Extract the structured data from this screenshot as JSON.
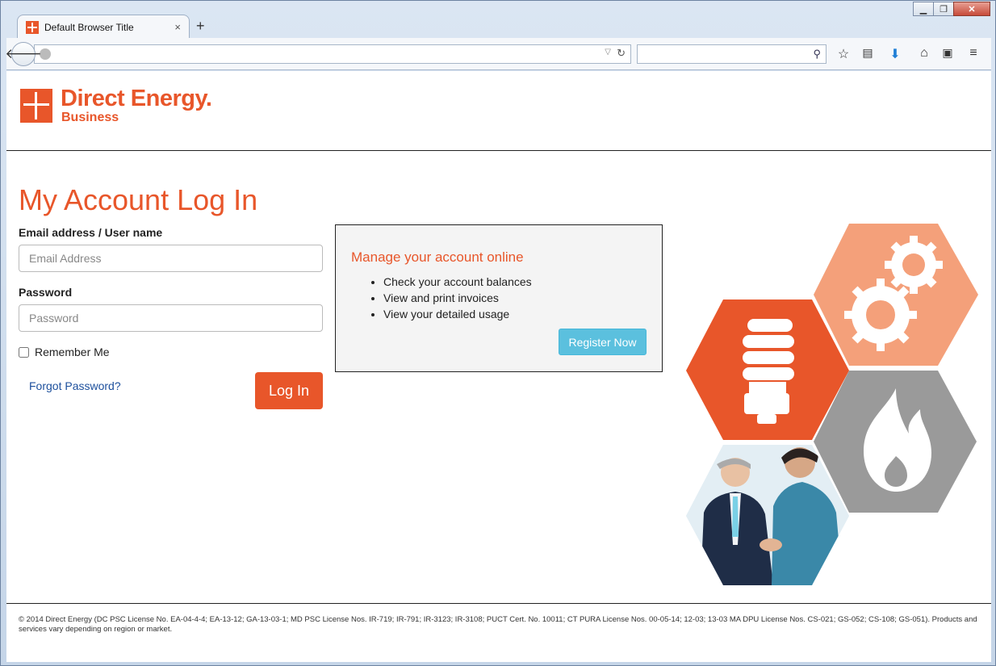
{
  "browser": {
    "tab_title": "Default Browser Title",
    "tab_close": "×",
    "new_tab": "+",
    "url": "",
    "search": ""
  },
  "logo": {
    "main": "Direct Energy.",
    "sub": "Business"
  },
  "login": {
    "title": "My Account Log In",
    "email_label": "Email address / User name",
    "email_placeholder": "Email Address",
    "password_label": "Password",
    "password_placeholder": "Password",
    "remember_label": "Remember Me",
    "forgot_link": "Forgot Password?",
    "login_button": "Log In"
  },
  "info": {
    "title": "Manage your account online",
    "items": [
      "Check your account balances",
      "View and print invoices",
      "View your detailed usage"
    ],
    "register_button": "Register Now"
  },
  "footer": {
    "text": "© 2014 Direct Energy (DC PSC License No. EA-04-4-4; EA-13-12; GA-13-03-1; MD PSC License Nos. IR-719; IR-791; IR-3123; IR-3108; PUCT Cert. No. 10011; CT PURA License Nos. 00-05-14; 12-03; 13-03 MA DPU License Nos. CS-021; GS-052; CS-108; GS-051). Products and services vary depending on region or market."
  },
  "colors": {
    "brand_orange": "#e8562a",
    "light_orange": "#f4a07a",
    "gray": "#9a9a9a",
    "register_blue": "#5bc0de"
  },
  "icons": [
    "back-arrow-icon",
    "globe-icon",
    "reload-icon",
    "search-icon",
    "bookmark-star-icon",
    "reading-list-icon",
    "download-icon",
    "home-icon",
    "pocket-icon",
    "menu-icon",
    "lightbulb-icon",
    "gears-icon",
    "flame-icon"
  ]
}
